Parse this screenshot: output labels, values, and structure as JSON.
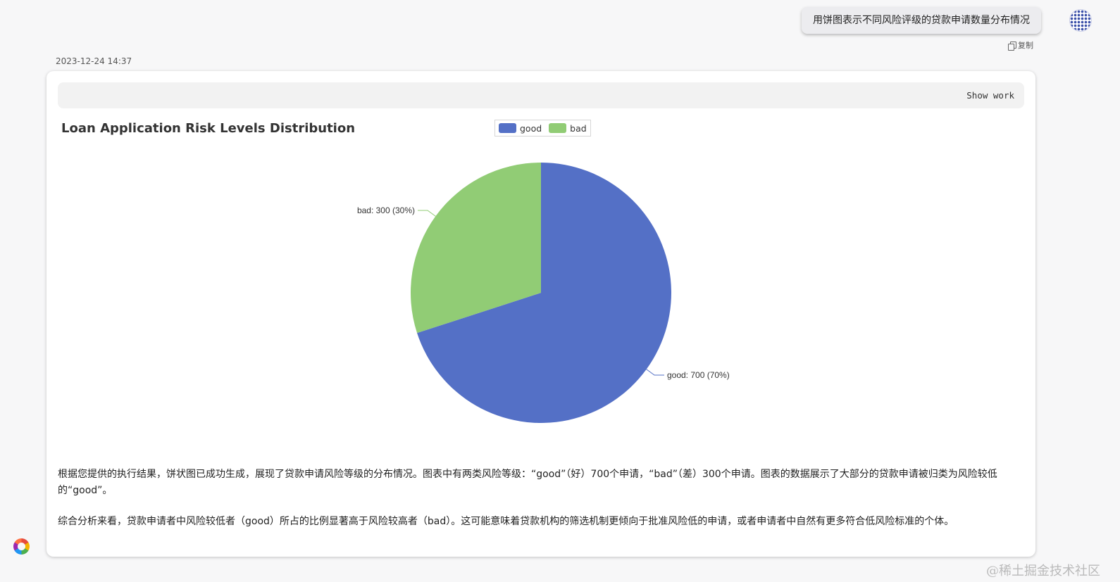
{
  "user_message": {
    "text": "用饼图表示不同风险评级的贷款申请数量分布情况",
    "copy_label": "复制"
  },
  "response": {
    "timestamp": "2023-12-24 14:37",
    "show_work_label": "Show work",
    "analysis": [
      "根据您提供的执行结果，饼状图已成功生成，展现了贷款申请风险等级的分布情况。图表中有两类风险等级：“good”（好）700个申请，“bad”（差）300个申请。图表的数据展示了大部分的贷款申请被归类为风险较低的“good”。",
      "综合分析来看，贷款申请者中风险较低者（good）所占的比例显著高于风险较高者（bad）。这可能意味着贷款机构的筛选机制更倾向于批准风险低的申请，或者申请者中自然有更多符合低风险标准的个体。"
    ]
  },
  "chart_data": {
    "type": "pie",
    "title": "Loan Application Risk Levels Distribution",
    "legend_position": "top-center",
    "series": [
      {
        "name": "good",
        "value": 700,
        "percent": 70,
        "color": "#5470c6",
        "label": "good: 700 (70%)"
      },
      {
        "name": "bad",
        "value": 300,
        "percent": 30,
        "color": "#91cc75",
        "label": "bad: 300 (30%)"
      }
    ]
  },
  "watermark": "@稀土掘金技术社区"
}
